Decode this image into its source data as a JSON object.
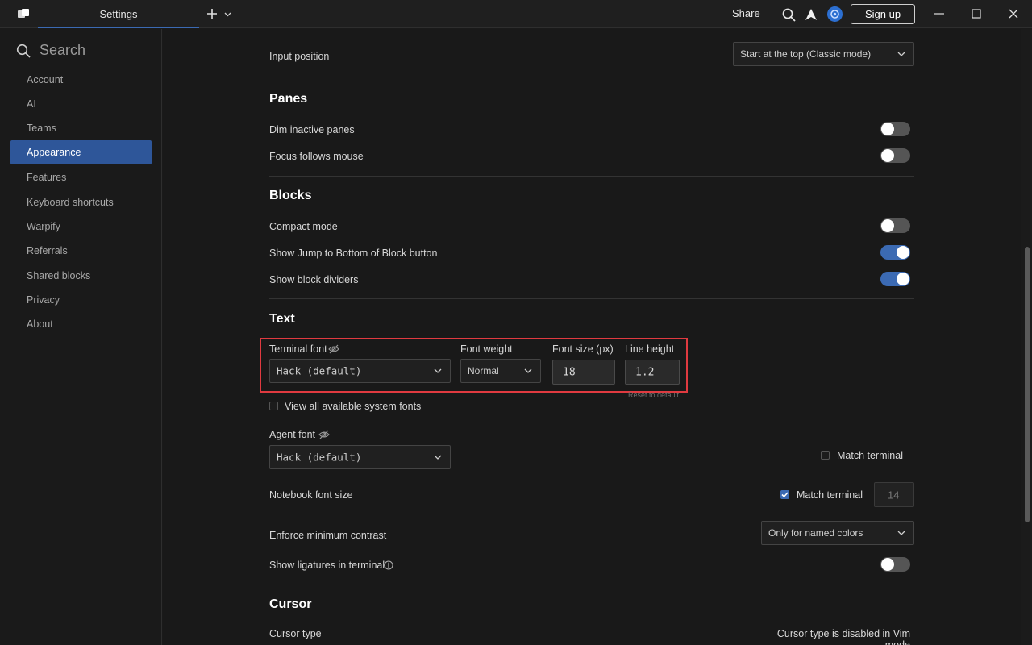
{
  "window": {
    "tab_label": "Settings",
    "share_label": "Share",
    "signup_label": "Sign up"
  },
  "sidebar": {
    "search_placeholder": "Search",
    "items": [
      {
        "label": "Account"
      },
      {
        "label": "AI"
      },
      {
        "label": "Teams"
      },
      {
        "label": "Appearance",
        "active": true
      },
      {
        "label": "Features"
      },
      {
        "label": "Keyboard shortcuts"
      },
      {
        "label": "Warpify"
      },
      {
        "label": "Referrals"
      },
      {
        "label": "Shared blocks"
      },
      {
        "label": "Privacy"
      },
      {
        "label": "About"
      }
    ]
  },
  "main": {
    "input_position": {
      "label": "Input position",
      "value": "Start at the top (Classic mode)"
    },
    "panes": {
      "title": "Panes",
      "dim_inactive": {
        "label": "Dim inactive panes",
        "on": false
      },
      "focus_follows_mouse": {
        "label": "Focus follows mouse",
        "on": false
      }
    },
    "blocks": {
      "title": "Blocks",
      "compact_mode": {
        "label": "Compact mode",
        "on": false
      },
      "jump_to_bottom": {
        "label": "Show Jump to Bottom of Block button",
        "on": true
      },
      "block_dividers": {
        "label": "Show block dividers",
        "on": true
      }
    },
    "text": {
      "title": "Text",
      "terminal_font": {
        "label": "Terminal font",
        "value": "Hack (default)"
      },
      "font_weight": {
        "label": "Font weight",
        "value": "Normal"
      },
      "font_size": {
        "label": "Font size (px)",
        "value": "18"
      },
      "line_height": {
        "label": "Line height",
        "value": "1.2"
      },
      "reset_label": "Reset to default",
      "view_all_fonts": {
        "label": "View all available system fonts",
        "checked": false
      },
      "agent_font": {
        "label": "Agent font",
        "value": "Hack (default)"
      },
      "agent_match_terminal": {
        "label": "Match terminal",
        "checked": false
      },
      "notebook_font_size": {
        "label": "Notebook font size",
        "match_label": "Match terminal",
        "checked": true,
        "value": "14"
      },
      "min_contrast": {
        "label": "Enforce minimum contrast",
        "value": "Only for named colors"
      },
      "ligatures": {
        "label": "Show ligatures in terminal",
        "on": false
      }
    },
    "cursor": {
      "title": "Cursor",
      "cursor_type": {
        "label": "Cursor type",
        "value": "Cursor type is disabled in Vim mode"
      }
    }
  },
  "colors": {
    "accent": "#3b6ab3",
    "highlight": "#e03a40"
  }
}
